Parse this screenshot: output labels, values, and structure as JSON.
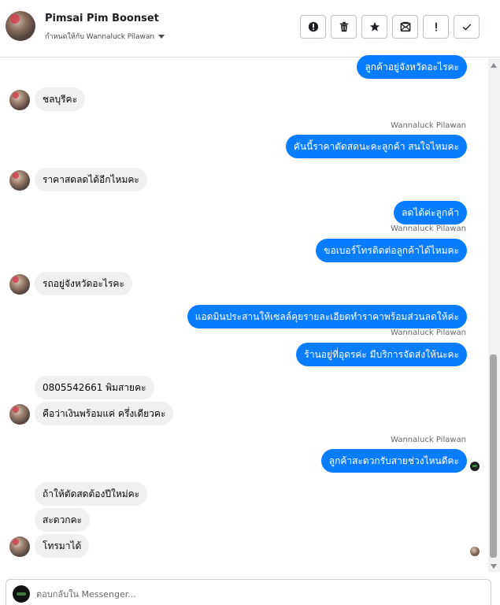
{
  "header": {
    "contact_name": "Pimsai Pim Boonset",
    "assigned_label": "กำหนดให้กับ Wannaluck Pilawan",
    "tools": [
      {
        "name": "alert-circle-icon",
        "label": "spam"
      },
      {
        "name": "trash-icon",
        "label": "delete"
      },
      {
        "name": "star-icon",
        "label": "star"
      },
      {
        "name": "mail-icon",
        "label": "mark unread"
      },
      {
        "name": "exclamation-icon",
        "label": "follow up"
      },
      {
        "name": "check-icon",
        "label": "done"
      }
    ]
  },
  "messages": [
    {
      "dir": "out",
      "text": "ลูกค้าอยู่จังหวัดอะไรคะ"
    },
    {
      "dir": "in",
      "text": "ชลบุรีคะ"
    },
    {
      "dir": "sender",
      "text": "Wannaluck Pilawan"
    },
    {
      "dir": "out",
      "text": "คันนี้ราคาตัดสดนะคะลูกค้า สนใจไหมคะ"
    },
    {
      "dir": "in",
      "text": "ราคาสดลดได้อีกไหมคะ"
    },
    {
      "dir": "out",
      "text": "ลดได้ค่ะลูกค้า"
    },
    {
      "dir": "sender",
      "text": "Wannaluck Pilawan"
    },
    {
      "dir": "out",
      "text": "ขอเบอร์โทรติดต่อลูกค้าได้ไหมคะ"
    },
    {
      "dir": "in",
      "text": "รถอยู่จังหวัดอะไรคะ"
    },
    {
      "dir": "out",
      "text": "แอดมินประสานให้เซลล์คุยรายละเอียดทำราคาพร้อมส่วนลดให้ค่ะ"
    },
    {
      "dir": "sender",
      "text": "Wannaluck Pilawan"
    },
    {
      "dir": "out",
      "text": "ร้านอยู่ที่อุดรค่ะ  มีบริการจัดส่งให้นะคะ"
    },
    {
      "dir": "in",
      "text": "0805542661 พิมสายคะ"
    },
    {
      "dir": "in",
      "text": "คือว่าเงินพร้อมแค่ ครึ่งเดียวคะ"
    },
    {
      "dir": "sender",
      "text": "Wannaluck Pilawan"
    },
    {
      "dir": "out",
      "text": "ลูกค้าสะดวกรับสายช่วงไหนดีคะ"
    },
    {
      "dir": "in",
      "text": "ถ้าให้ตัดสดต้องปีใหม่คะ"
    },
    {
      "dir": "in",
      "text": "สะดวกคะ"
    },
    {
      "dir": "in",
      "text": "โทรมาได้"
    }
  ],
  "composer": {
    "placeholder": "ตอบกลับใน Messenger..."
  }
}
